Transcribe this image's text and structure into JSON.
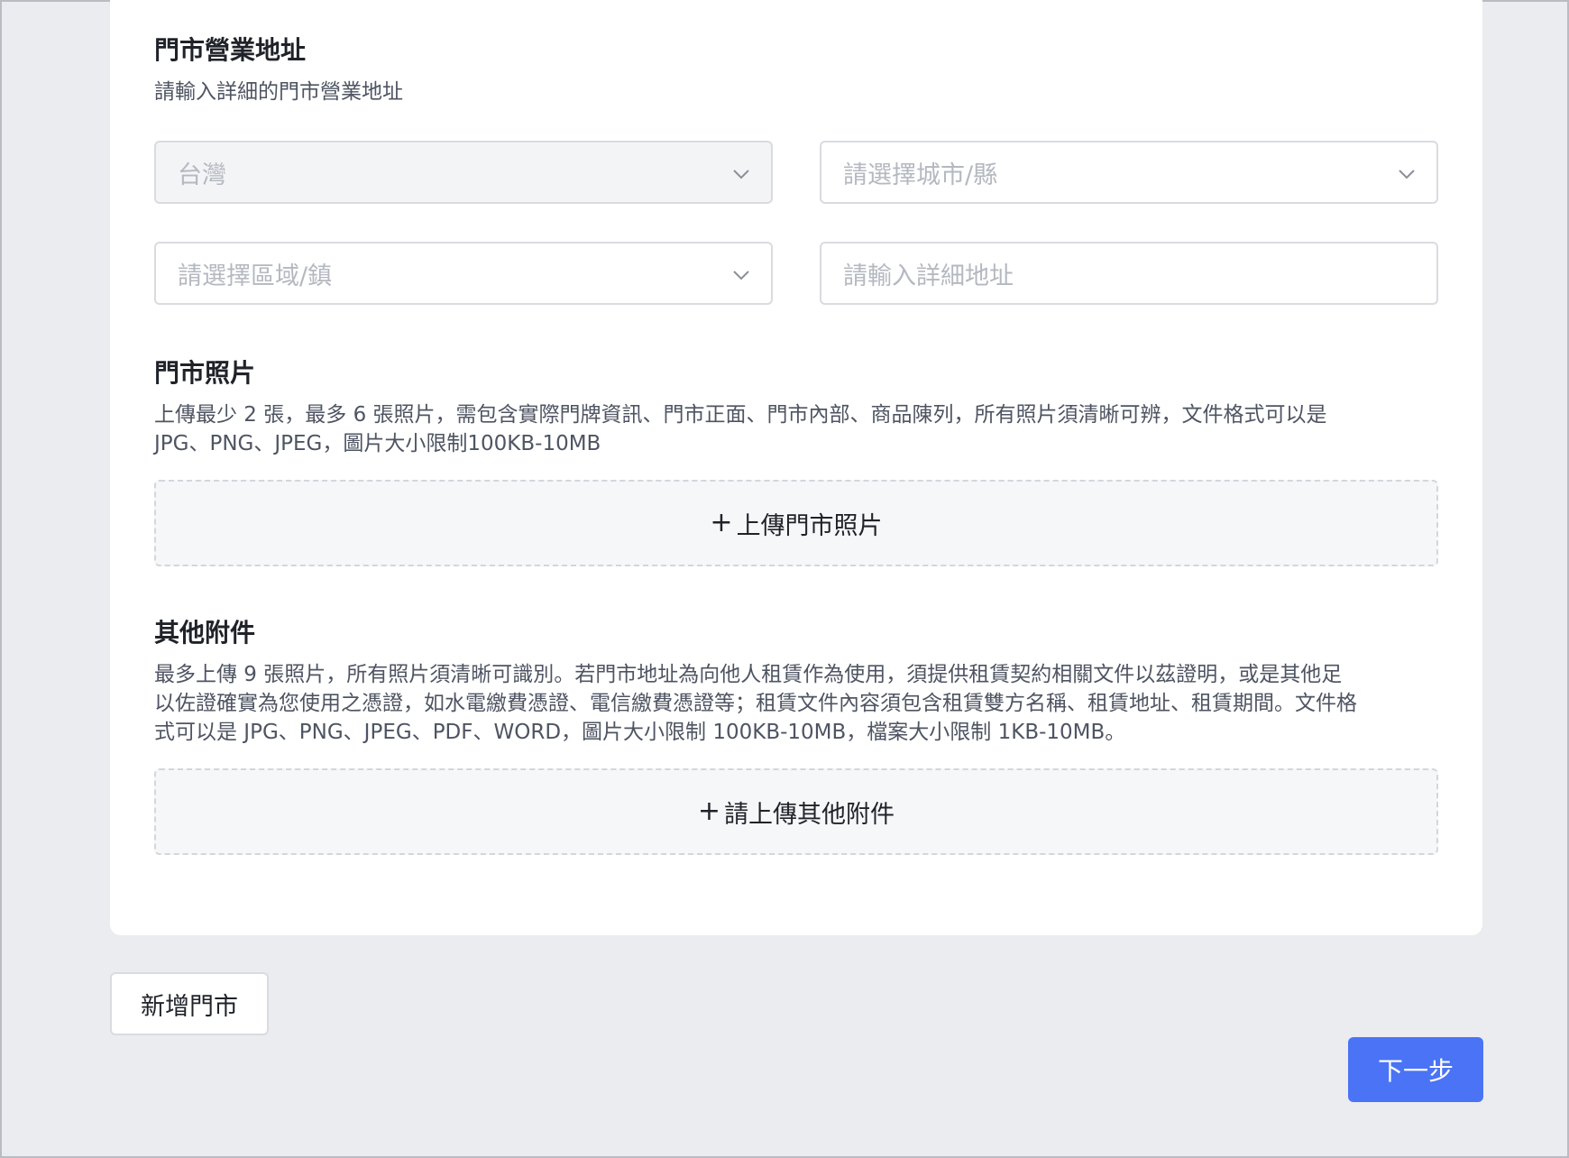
{
  "address": {
    "title": "門市營業地址",
    "desc": "請輸入詳細的門市營業地址",
    "country_value": "台灣",
    "city_placeholder": "請選擇城市/縣",
    "district_placeholder": "請選擇區域/鎮",
    "detail_placeholder": "請輸入詳細地址"
  },
  "photos": {
    "title": "門市照片",
    "desc_line1": "上傳最少 2 張，最多 6 張照片，需包含實際門牌資訊、門市正面、門市內部、商品陳列，所有照片須清晰可辨，文件格式可以是",
    "desc_line2": "JPG、PNG、JPEG，圖片大小限制100KB-10MB",
    "upload_label": "上傳門市照片"
  },
  "attachments": {
    "title": "其他附件",
    "desc_line1": "最多上傳 9 張照片，所有照片須清晰可識別。若門市地址為向他人租賃作為使用，須提供租賃契約相關文件以茲證明，或是其他足",
    "desc_line2": "以佐證確實為您使用之憑證，如水電繳費憑證、電信繳費憑證等；租賃文件內容須包含租賃雙方名稱、租賃地址、租賃期間。文件格",
    "desc_line3": "式可以是 JPG、PNG、JPEG、PDF、WORD，圖片大小限制 100KB-10MB，檔案大小限制 1KB-10MB。",
    "upload_label": "請上傳其他附件"
  },
  "actions": {
    "add_store_label": "新增門市",
    "next_label": "下一步"
  },
  "icons": {
    "dropdown": "chevron-down-icon",
    "upload": "plus-icon"
  },
  "colors": {
    "primary": "#4a74f5",
    "page_bg": "#ebecf0",
    "placeholder": "#b4b8c0"
  }
}
